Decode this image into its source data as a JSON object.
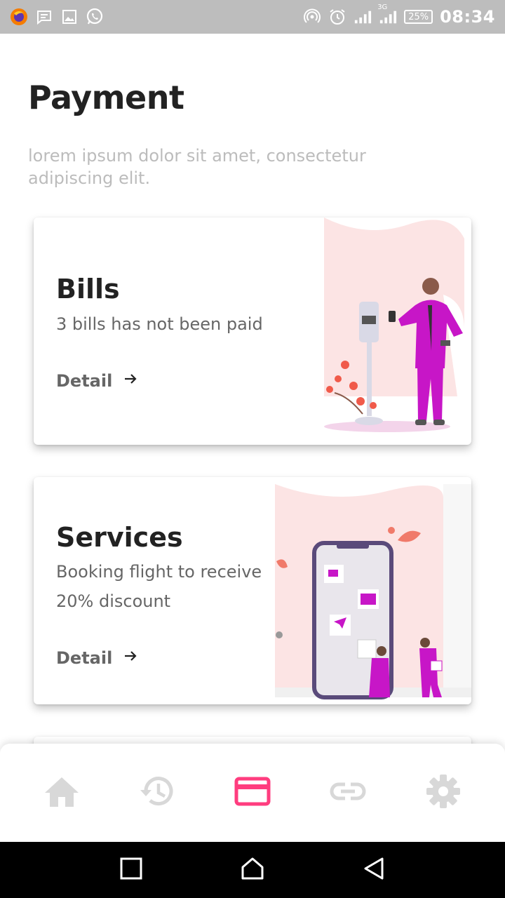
{
  "status_bar": {
    "battery": "25%",
    "time": "08:34",
    "network": "3G",
    "left_icons": [
      "firefox-icon",
      "message-icon",
      "image-icon",
      "whatsapp-icon"
    ],
    "right_icons": [
      "hotspot-icon",
      "alarm-icon",
      "signal-icon",
      "signal-3g-icon",
      "battery-icon"
    ]
  },
  "header": {
    "title": "Payment",
    "subtitle": "lorem ipsum dolor sit amet, consectetur adipiscing elit."
  },
  "cards": [
    {
      "title": "Bills",
      "description": "3 bills has not been paid",
      "link_label": "Detail"
    },
    {
      "title": "Services",
      "description_line1": "Booking flight to receive",
      "description_line2": "20% discount",
      "link_label": "Detail"
    }
  ],
  "bottom_nav": {
    "items": [
      "home-icon",
      "history-icon",
      "card-icon",
      "link-icon",
      "settings-icon"
    ],
    "active": "card-icon",
    "active_color": "#ff3d7f",
    "inactive_color": "#d8d8d8"
  },
  "colors": {
    "accent": "#ff3d7f",
    "illustration_purple": "#c716c7",
    "illustration_pink": "#fce4e4"
  }
}
